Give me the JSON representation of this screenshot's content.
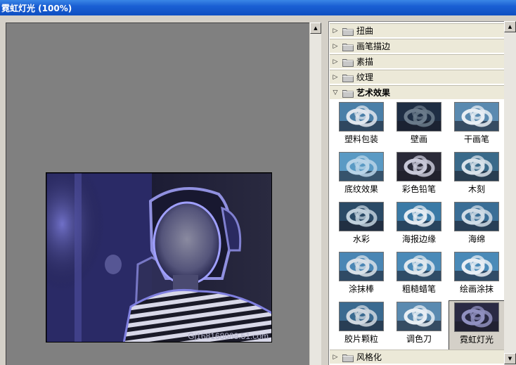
{
  "window": {
    "title": "霓虹灯光 (100%)"
  },
  "preview": {
    "watermark": "Gj168168888.51.com"
  },
  "categories_top": [
    {
      "label": "扭曲",
      "state": "collapsed"
    },
    {
      "label": "画笔描边",
      "state": "collapsed"
    },
    {
      "label": "素描",
      "state": "collapsed"
    },
    {
      "label": "纹理",
      "state": "collapsed"
    },
    {
      "label": "艺术效果",
      "state": "expanded"
    }
  ],
  "filters": [
    {
      "label": "塑料包装",
      "bg": "#4a7fa8",
      "fg": "#e0e6ee"
    },
    {
      "label": "壁画",
      "bg": "#1e2e44",
      "fg": "#6a7a8a"
    },
    {
      "label": "干画笔",
      "bg": "#5a8ab0",
      "fg": "#e8eef4"
    },
    {
      "label": "底纹效果",
      "bg": "#5a9ac4",
      "fg": "#b8d4e8"
    },
    {
      "label": "彩色铅笔",
      "bg": "#2a2a38",
      "fg": "#c8c8d8"
    },
    {
      "label": "木刻",
      "bg": "#3a6a8a",
      "fg": "#d8e2ea"
    },
    {
      "label": "水彩",
      "bg": "#2a4a66",
      "fg": "#c0d0dc"
    },
    {
      "label": "海报边缘",
      "bg": "#3a7aa6",
      "fg": "#e4ecf2"
    },
    {
      "label": "海绵",
      "bg": "#3a6e96",
      "fg": "#d0dce6"
    },
    {
      "label": "涂抹棒",
      "bg": "#4a86b4",
      "fg": "#d8e0e8"
    },
    {
      "label": "粗糙蜡笔",
      "bg": "#4a8ab8",
      "fg": "#e0e8ee"
    },
    {
      "label": "绘画涂抹",
      "bg": "#4a8ab8",
      "fg": "#e8eef4"
    },
    {
      "label": "胶片颗粒",
      "bg": "#3a6a90",
      "fg": "#d0d8e0"
    },
    {
      "label": "调色刀",
      "bg": "#5a8ab0",
      "fg": "#e8eef4"
    },
    {
      "label": "霓虹灯光",
      "bg": "#2a2a44",
      "fg": "#9090c0",
      "selected": true
    }
  ],
  "categories_bottom": [
    {
      "label": "风格化",
      "state": "collapsed"
    }
  ],
  "icons": {
    "collapsed": "triangle-right-icon",
    "expanded": "triangle-down-icon",
    "folder": "folder-icon"
  }
}
